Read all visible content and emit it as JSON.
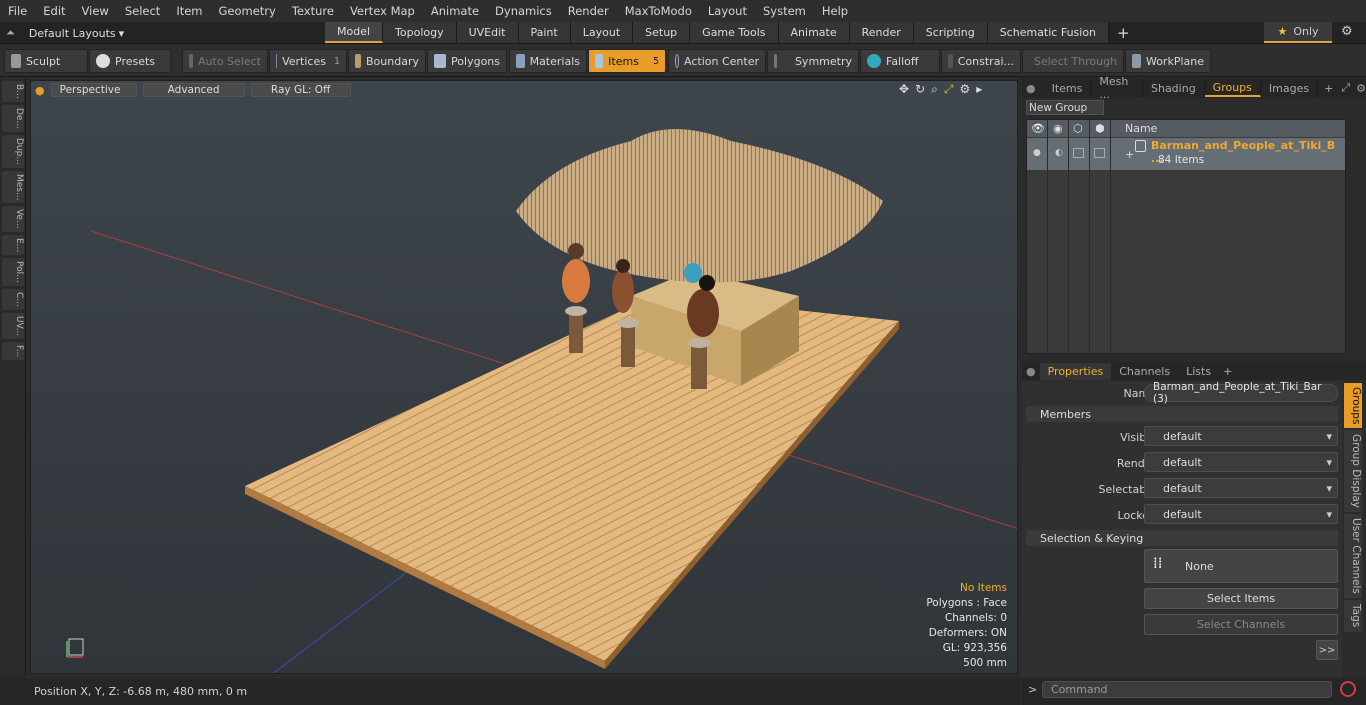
{
  "menu": [
    "File",
    "Edit",
    "View",
    "Select",
    "Item",
    "Geometry",
    "Texture",
    "Vertex Map",
    "Animate",
    "Dynamics",
    "Render",
    "MaxToModo",
    "Layout",
    "System",
    "Help"
  ],
  "layouts": {
    "label": "Default Layouts"
  },
  "mode_tabs": [
    "Model",
    "Topology",
    "UVEdit",
    "Paint",
    "Layout",
    "Setup",
    "Game Tools",
    "Animate",
    "Render",
    "Scripting",
    "Schematic Fusion"
  ],
  "only_label": "Only",
  "toolbar": {
    "sculpt": "Sculpt",
    "presets": "Presets",
    "auto_select": "Auto Select",
    "vertices": "Vertices",
    "vertices_count": "1",
    "boundary": "Boundary",
    "polygons": "Polygons",
    "materials": "Materials",
    "items": "Items",
    "items_count": "5",
    "action_center": "Action Center",
    "symmetry": "Symmetry",
    "falloff": "Falloff",
    "constraints": "Constrai...",
    "select_through": "Select Through",
    "workplane": "WorkPlane"
  },
  "left_tabs": [
    "B...",
    "De...",
    "Dup...",
    "Mes...",
    "Ve...",
    "E...",
    "Pol...",
    "C...",
    "UV...",
    "F..."
  ],
  "viewport": {
    "perspective": "Perspective",
    "advanced": "Advanced",
    "raygl": "Ray GL: Off",
    "info": [
      "No Items",
      "Polygons : Face",
      "Channels: 0",
      "Deformers: ON",
      "GL: 923,356",
      "500 mm"
    ]
  },
  "status": {
    "position": "Position X, Y, Z:   -6.68 m, 480 mm, 0 m"
  },
  "right_tabs": [
    "Items",
    "Mesh ...",
    "Shading",
    "Groups",
    "Images"
  ],
  "groups": {
    "new_group": "New Group",
    "col_name": "Name",
    "row_name": "Barman_and_People_at_Tiki_B ...",
    "row_count": "84 Items"
  },
  "props_tabs": [
    "Properties",
    "Channels",
    "Lists"
  ],
  "properties": {
    "name_label": "Name",
    "name_value": "Barman_and_People_at_Tiki_Bar (3)",
    "members": "Members",
    "visible_label": "Visible",
    "visible_value": "default",
    "render_label": "Render",
    "render_value": "default",
    "selectable_label": "Selectable",
    "selectable_value": "default",
    "locked_label": "Locked",
    "locked_value": "default",
    "selection_keying": "Selection & Keying",
    "none": "None",
    "select_items": "Select Items",
    "select_channels": "Select Channels",
    "more": ">>"
  },
  "vertical_tabs": [
    "Groups",
    "Group Display",
    "User Channels",
    "Tags"
  ],
  "command": {
    "placeholder": "Command"
  }
}
